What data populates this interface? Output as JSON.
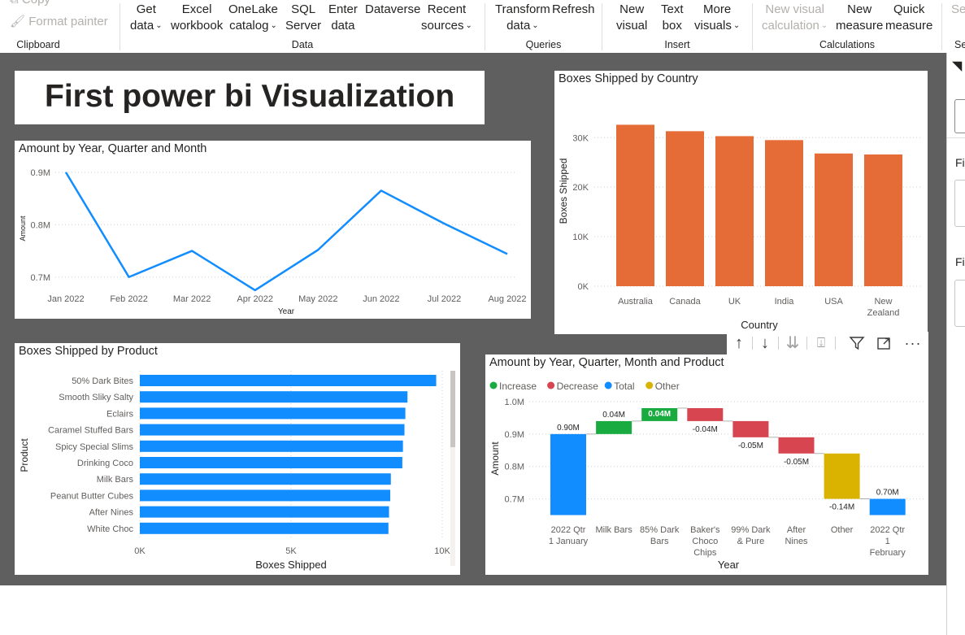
{
  "ribbon": {
    "clipboard": {
      "copy": "Copy",
      "format_painter": "Format painter",
      "group": "Clipboard"
    },
    "data": {
      "get_data": [
        "Get",
        "data"
      ],
      "excel": [
        "Excel",
        "workbook"
      ],
      "onelake": [
        "OneLake",
        "catalog"
      ],
      "sql": [
        "SQL",
        "Server"
      ],
      "enter": [
        "Enter",
        "data"
      ],
      "dataverse": "Dataverse",
      "recent": [
        "Recent",
        "sources"
      ],
      "group": "Data"
    },
    "queries": {
      "transform": [
        "Transform",
        "data"
      ],
      "refresh": "Refresh",
      "group": "Queries"
    },
    "insert": {
      "new_visual": [
        "New",
        "visual"
      ],
      "text_box": [
        "Text",
        "box"
      ],
      "more": [
        "More",
        "visuals"
      ],
      "group": "Insert"
    },
    "calculations": {
      "new_visual_calc": [
        "New visual",
        "calculation"
      ],
      "new_measure": [
        "New",
        "measure"
      ],
      "quick_measure": [
        "Quick",
        "measure"
      ],
      "group": "Calculations"
    },
    "partial_button": "Se",
    "partial_group": "Se"
  },
  "right_pane": {
    "label_a": "Fi",
    "label_b": "Fi"
  },
  "report_title": "First power bi Visualization",
  "colors": {
    "line": "#118dff",
    "bar_orange": "#e66c37",
    "bar_blue": "#118dff",
    "increase": "#1aab40",
    "decrease": "#d64550",
    "total": "#118dff",
    "other": "#d9b300"
  },
  "visual_header": {
    "icons": [
      "arrow-up-icon",
      "arrow-down-icon",
      "double-arrow-down-icon",
      "expand-hierarchy-icon",
      "filter-icon",
      "focus-mode-icon",
      "more-options-icon"
    ]
  },
  "charts": {
    "line": {
      "title": "Amount by Year, Quarter and Month",
      "xlabel": "Year",
      "ylabel": "Amount",
      "categories": [
        "Jan 2022",
        "Feb 2022",
        "Mar 2022",
        "Apr 2022",
        "May 2022",
        "Jun 2022",
        "Jul 2022",
        "Aug 2022"
      ],
      "yticks": [
        "0.9M",
        "0.8M",
        "0.7M"
      ]
    },
    "country": {
      "title": "Boxes Shipped by Country",
      "xlabel": "Country",
      "ylabel": "Boxes Shipped",
      "categories": [
        "Australia",
        "Canada",
        "UK",
        "India",
        "USA",
        "New Zealand"
      ],
      "yticks": [
        "30K",
        "20K",
        "10K",
        "0K"
      ]
    },
    "product": {
      "title": "Boxes Shipped by Product",
      "xlabel": "Boxes Shipped",
      "ylabel": "Product",
      "categories": [
        "50% Dark Bites",
        "Smooth Sliky Salty",
        "Eclairs",
        "Caramel Stuffed Bars",
        "Spicy Special Slims",
        "Drinking Coco",
        "Milk Bars",
        "Peanut Butter Cubes",
        "After Nines",
        "White Choc"
      ],
      "xticks": [
        "0K",
        "5K",
        "10K"
      ]
    },
    "waterfall": {
      "title": "Amount by Year, Quarter, Month and Product",
      "xlabel": "Year",
      "ylabel": "Amount",
      "legend": [
        "Increase",
        "Decrease",
        "Total",
        "Other"
      ],
      "categories": [
        "2022 Qtr 1 January",
        "Milk Bars",
        "85% Dark Bars",
        "Baker's Choco Chips",
        "99% Dark & Pure",
        "After Nines",
        "Other",
        "2022 Qtr 1 February"
      ],
      "yticks": [
        "1.0M",
        "0.9M",
        "0.8M",
        "0.7M"
      ],
      "data_labels": [
        "0.90M",
        "0.04M",
        "0.04M",
        "-0.04M",
        "-0.05M",
        "-0.05M",
        "-0.14M",
        "0.70M"
      ]
    }
  },
  "chart_data": [
    {
      "type": "line",
      "title": "Amount by Year, Quarter and Month",
      "xlabel": "Year",
      "ylabel": "Amount",
      "x": [
        "Jan 2022",
        "Feb 2022",
        "Mar 2022",
        "Apr 2022",
        "May 2022",
        "Jun 2022",
        "Jul 2022",
        "Aug 2022"
      ],
      "values": [
        900000,
        700000,
        750000,
        675000,
        752000,
        865000,
        802000,
        744000
      ],
      "ylim": [
        650000,
        920000
      ],
      "grid": true
    },
    {
      "type": "bar",
      "title": "Boxes Shipped by Country",
      "xlabel": "Country",
      "ylabel": "Boxes Shipped",
      "categories": [
        "Australia",
        "Canada",
        "UK",
        "India",
        "USA",
        "New Zealand"
      ],
      "values": [
        32600,
        31300,
        30300,
        29500,
        26800,
        26600
      ],
      "ylim": [
        0,
        33000
      ],
      "grid": true
    },
    {
      "type": "bar",
      "orientation": "horizontal",
      "title": "Boxes Shipped by Product",
      "xlabel": "Boxes Shipped",
      "ylabel": "Product",
      "categories": [
        "50% Dark Bites",
        "Smooth Sliky Salty",
        "Eclairs",
        "Caramel Stuffed Bars",
        "Spicy Special Slims",
        "Drinking Coco",
        "Milk Bars",
        "Peanut Butter Cubes",
        "After Nines",
        "White Choc"
      ],
      "values": [
        9800,
        8850,
        8780,
        8750,
        8700,
        8680,
        8300,
        8280,
        8240,
        8220
      ],
      "xlim": [
        0,
        10000
      ],
      "grid": true
    },
    {
      "type": "waterfall",
      "title": "Amount by Year, Quarter, Month and Product",
      "xlabel": "Year",
      "ylabel": "Amount",
      "categories": [
        "2022 Qtr 1 January",
        "Milk Bars",
        "85% Dark Bars",
        "Baker's Choco Chips",
        "99% Dark & Pure",
        "After Nines",
        "Other",
        "2022 Qtr 1 February"
      ],
      "values": [
        0.9,
        0.04,
        0.04,
        -0.04,
        -0.05,
        -0.05,
        -0.14,
        0.7
      ],
      "kinds": [
        "total",
        "increase",
        "increase",
        "decrease",
        "decrease",
        "decrease",
        "other",
        "total"
      ],
      "unit": "M",
      "ylim": [
        0.65,
        1.0
      ],
      "legend": [
        "Increase",
        "Decrease",
        "Total",
        "Other"
      ],
      "legend_position": "top-left",
      "grid": true
    }
  ]
}
